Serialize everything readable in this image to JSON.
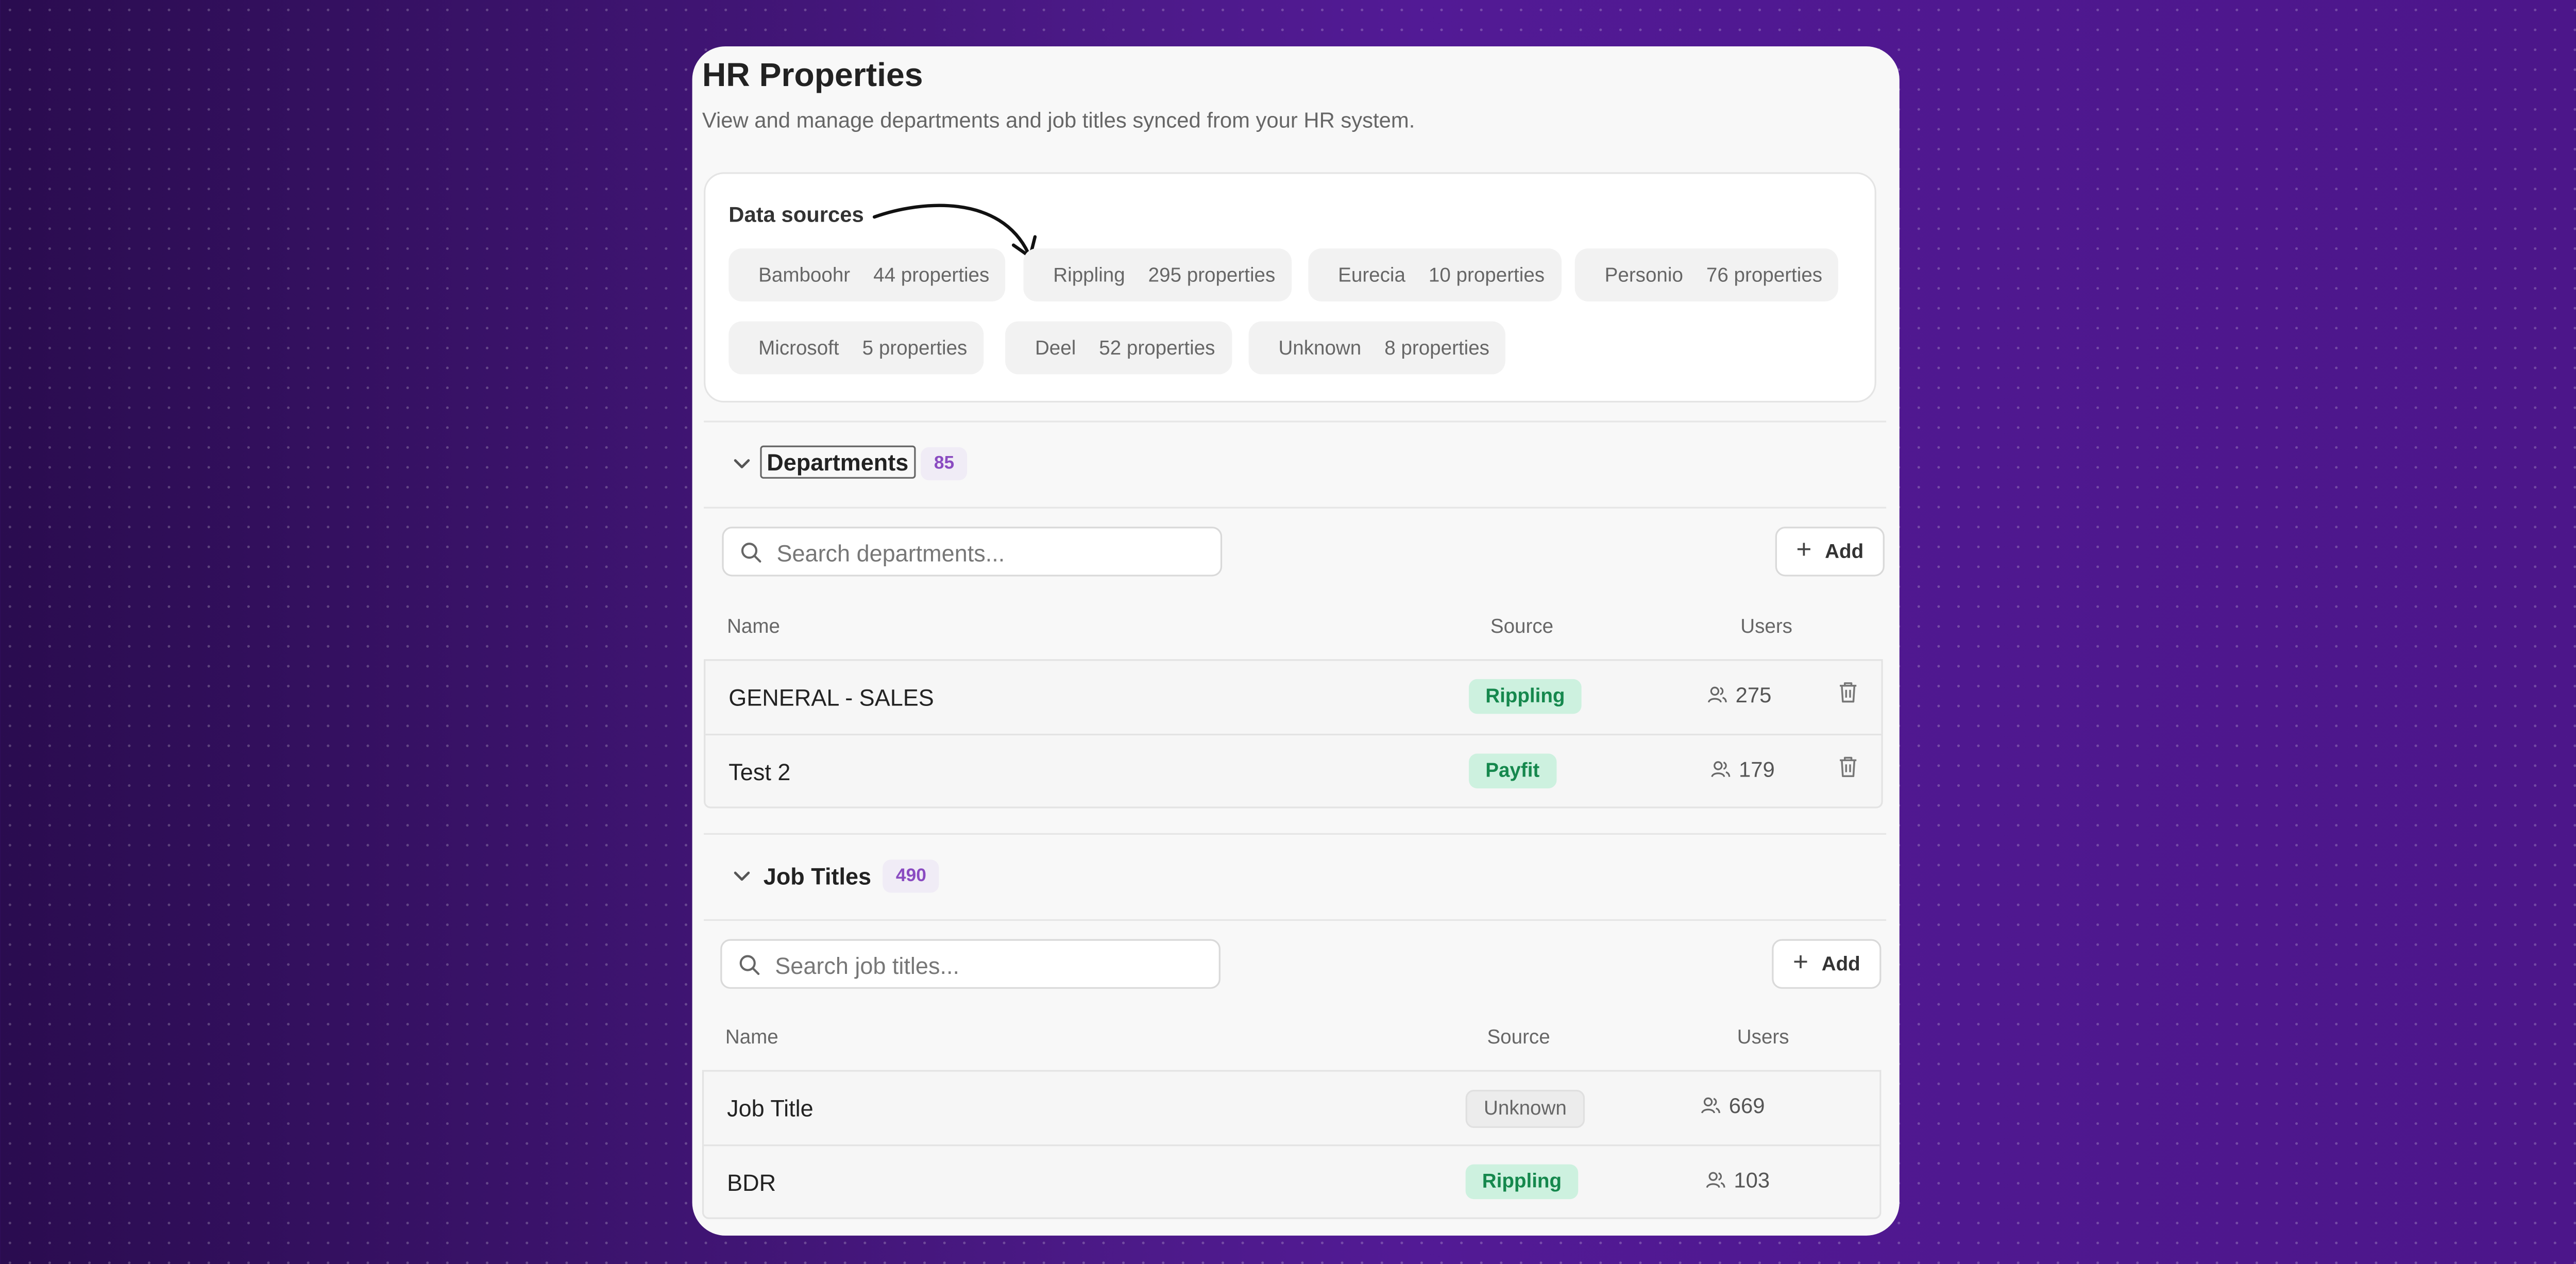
{
  "page": {
    "title": "HR Properties",
    "subtitle": "View and manage departments and job titles synced from your HR system."
  },
  "data_sources": {
    "label": "Data sources",
    "items": [
      {
        "name": "Bamboohr",
        "count": "44 properties"
      },
      {
        "name": "Rippling",
        "count": "295 properties"
      },
      {
        "name": "Eurecia",
        "count": "10 properties"
      },
      {
        "name": "Personio",
        "count": "76 properties"
      },
      {
        "name": "Microsoft",
        "count": "5 properties"
      },
      {
        "name": "Deel",
        "count": "52 properties"
      },
      {
        "name": "Unknown",
        "count": "8 properties"
      }
    ]
  },
  "departments": {
    "title": "Departments",
    "count": "85",
    "search_placeholder": "Search departments...",
    "add_label": "Add",
    "columns": {
      "name": "Name",
      "source": "Source",
      "users": "Users"
    },
    "rows": [
      {
        "name": "GENERAL - SALES",
        "source": "Rippling",
        "users": "275"
      },
      {
        "name": "Test 2",
        "source": "Payfit",
        "users": "179"
      }
    ]
  },
  "job_titles": {
    "title": "Job Titles",
    "count": "490",
    "search_placeholder": "Search job titles...",
    "add_label": "Add",
    "columns": {
      "name": "Name",
      "source": "Source",
      "users": "Users"
    },
    "rows": [
      {
        "name": "Job Title",
        "source": "Unknown",
        "users": "669"
      },
      {
        "name": "BDR",
        "source": "Rippling",
        "users": "103"
      }
    ]
  },
  "colors": {
    "accent_purple": "#8a4bc1",
    "source_green_bg": "#cdf1df",
    "source_green_text": "#15884d",
    "source_unknown_bg": "#ececec"
  },
  "icons": [
    "arrow-curved-icon",
    "chevron-down-icon",
    "search-icon",
    "plus-icon",
    "users-icon",
    "trash-icon"
  ]
}
